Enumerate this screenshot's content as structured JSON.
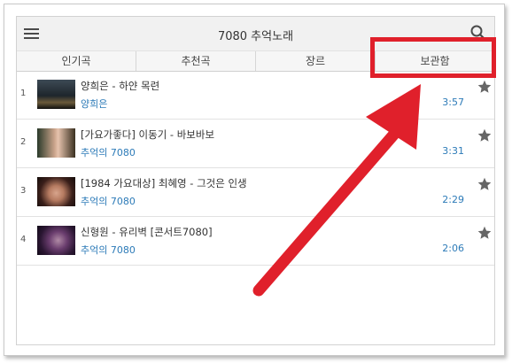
{
  "header": {
    "title": "7080 추억노래",
    "menu_icon": "hamburger-menu-icon",
    "search_icon": "search-icon"
  },
  "tabs": [
    {
      "label": "인기곡"
    },
    {
      "label": "추천곡"
    },
    {
      "label": "장르"
    },
    {
      "label": "보관함"
    }
  ],
  "songs": [
    {
      "num": "1",
      "title": "양희은 - 하얀 목련",
      "sub": "양희은",
      "duration": "3:57"
    },
    {
      "num": "2",
      "title": "[가요가좋다] 이동기 - 바보바보",
      "sub": "추억의 7080",
      "duration": "3:31"
    },
    {
      "num": "3",
      "title": "[1984 가요대상] 최혜영 - 그것은 인생",
      "sub": "추억의 7080",
      "duration": "2:29"
    },
    {
      "num": "4",
      "title": "신형원 - 유리벽 [콘서트7080]",
      "sub": "추억의 7080",
      "duration": "2:06"
    }
  ],
  "colors": {
    "accent_blue": "#2d7bb8",
    "highlight_red": "#e0202b"
  }
}
